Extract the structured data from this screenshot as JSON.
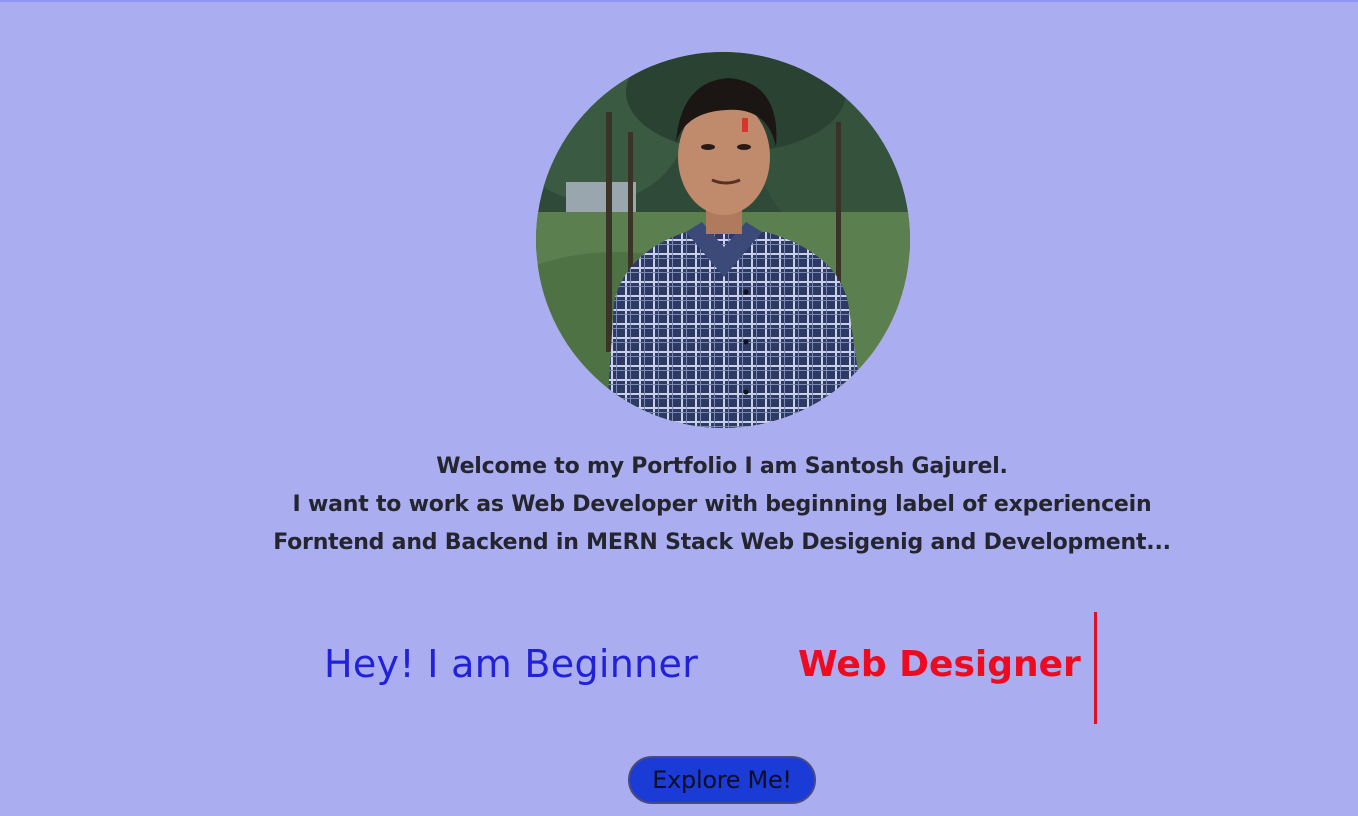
{
  "intro": {
    "line1": "Welcome to my Portfolio I am Santosh Gajurel.",
    "line2": "I want to work as Web Developer with beginning label of experiencein",
    "line3": "Forntend and Backend in MERN Stack Web Desigenig and Development..."
  },
  "tagline": {
    "greeting": "Hey! I am Beginner",
    "role": "Web Designer"
  },
  "cta": {
    "label": "Explore Me!"
  },
  "colors": {
    "background": "#aaaef0",
    "intro_text": "#25252f",
    "greeting": "#2121d9",
    "role": "#ee0a1f",
    "button": "#1a3bd6"
  }
}
